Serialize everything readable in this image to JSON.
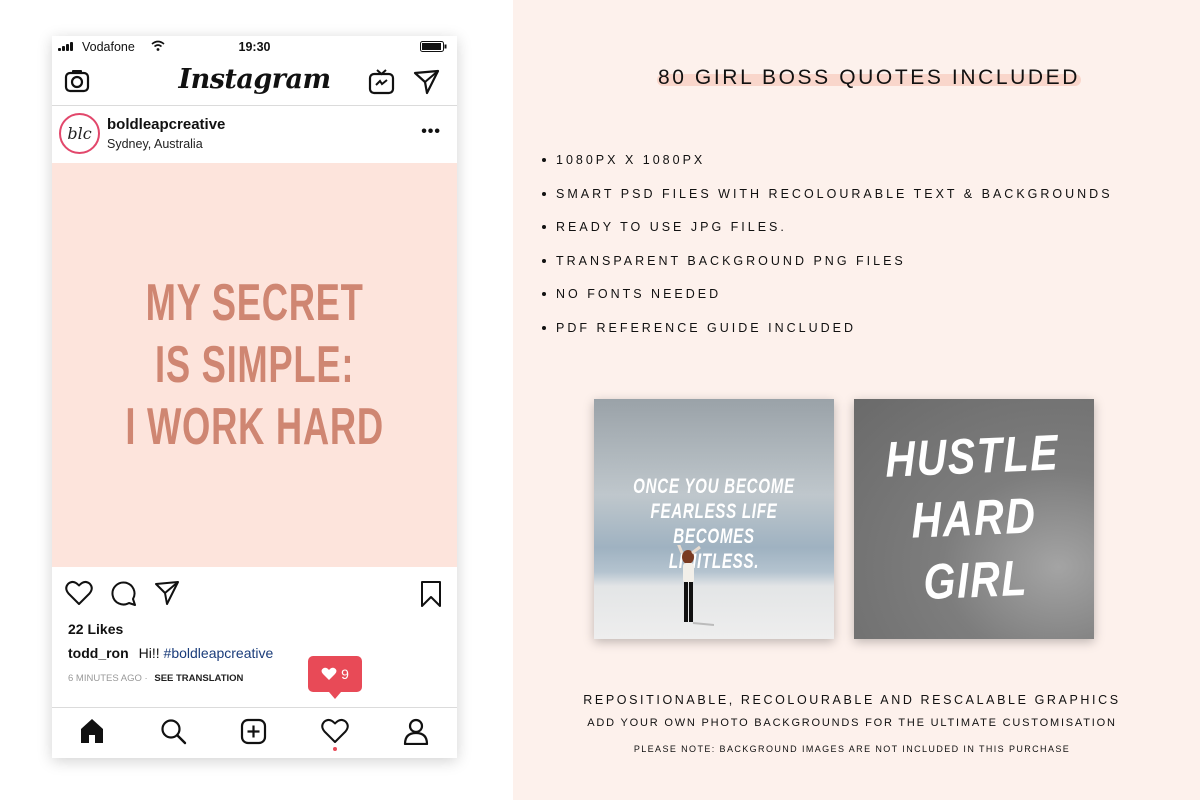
{
  "status_bar": {
    "carrier": "Vodafone",
    "time": "19:30"
  },
  "instagram": {
    "logo": "Instagram",
    "header_icons": [
      "camera-icon",
      "igtv-icon",
      "direct-message-icon"
    ],
    "post": {
      "username": "boldleapcreative",
      "location": "Sydney, Australia",
      "avatar_text": "blc",
      "quote_lines": [
        "MY SECRET",
        "IS SIMPLE:",
        "I WORK HARD"
      ],
      "likes": "22 Likes",
      "comment_user": "todd_ron",
      "comment_text": "Hi!!",
      "comment_hashtag": "#boldleapcreative",
      "time_ago": "6 MINUTES AGO",
      "see_translation": "SEE TRANSLATION"
    },
    "notification": {
      "count": "9"
    },
    "tab_icons": [
      "home-icon",
      "search-icon",
      "add-post-icon",
      "activity-icon",
      "profile-icon"
    ]
  },
  "promo": {
    "headline": "80 GIRL BOSS QUOTES INCLUDED",
    "features": [
      "1080PX X 1080PX",
      "SMART PSD FILES WITH RECOLOURABLE TEXT & BACKGROUNDS",
      "READY TO USE JPG FILES.",
      "TRANSPARENT BACKGROUND PNG FILES",
      "NO FONTS NEEDED",
      "PDF REFERENCE GUIDE INCLUDED"
    ],
    "preview1_text": "ONCE YOU BECOME FEARLESS LIFE BECOMES LIMITLESS.",
    "preview2_lines": [
      "HUSTLE",
      "HARD",
      "GIRL"
    ],
    "footer_line1": "REPOSITIONABLE, RECOLOURABLE AND RESCALABLE GRAPHICS",
    "footer_line2": "ADD YOUR OWN PHOTO BACKGROUNDS FOR THE ULTIMATE CUSTOMISATION",
    "footer_line3": "PLEASE NOTE: BACKGROUND IMAGES ARE NOT INCLUDED IN THIS PURCHASE"
  },
  "colors": {
    "quote": "#cf8672",
    "post_bg": "#fde4dc",
    "panel_bg": "#fdf1ec",
    "notification": "#e84a57"
  }
}
